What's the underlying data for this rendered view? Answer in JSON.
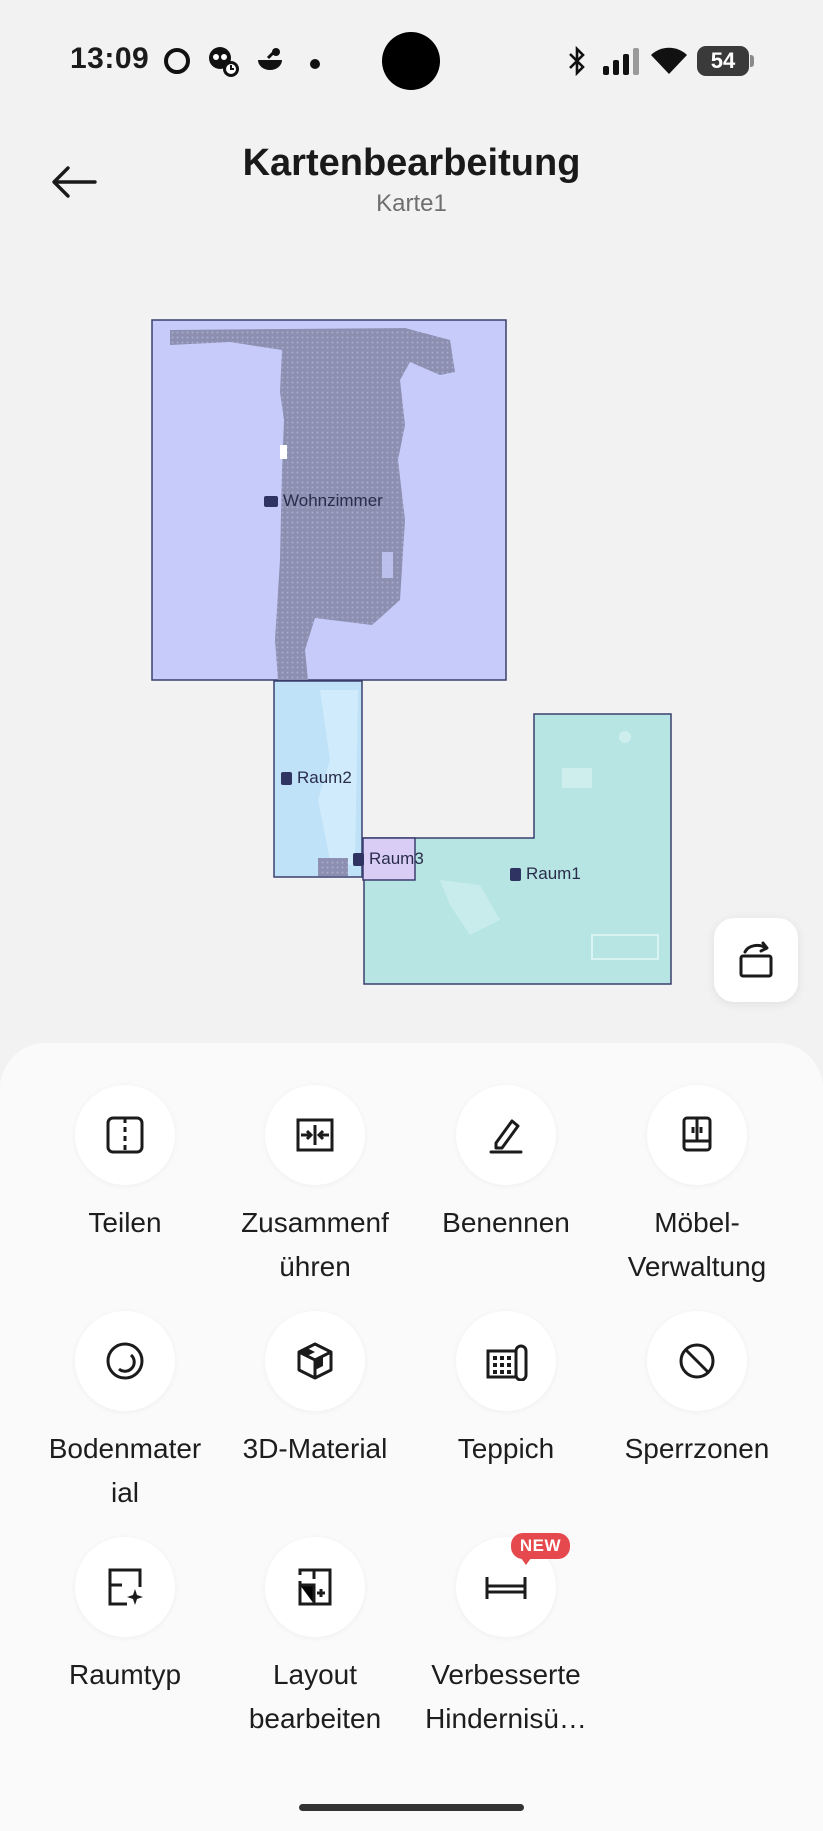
{
  "status_bar": {
    "time": "13:09",
    "battery": "54",
    "icons": [
      "circle-icon",
      "monkey-icon",
      "alarm-icon",
      "bluetooth-icon",
      "signal-icon",
      "wifi-icon",
      "battery-icon"
    ]
  },
  "header": {
    "title": "Kartenbearbeitung",
    "subtitle": "Karte1"
  },
  "map": {
    "rooms": [
      {
        "name": "Wohnzimmer",
        "color": "#c6cbfa"
      },
      {
        "name": "Raum2",
        "color": "#bfe2f8"
      },
      {
        "name": "Raum3",
        "color": "#d9cdf6"
      },
      {
        "name": "Raum1",
        "color": "#b6e5e4"
      }
    ]
  },
  "tools": [
    {
      "label": "Teilen",
      "icon": "split-icon"
    },
    {
      "label": "Zusammenf\nühren",
      "icon": "merge-icon"
    },
    {
      "label": "Benennen",
      "icon": "pencil-icon"
    },
    {
      "label": "Möbel-\nVerwaltung",
      "icon": "furniture-icon"
    },
    {
      "label": "Bodenmater\nial",
      "icon": "floor-material-icon"
    },
    {
      "label": "3D-Material",
      "icon": "cube-icon"
    },
    {
      "label": "Teppich",
      "icon": "carpet-icon"
    },
    {
      "label": "Sperrzonen",
      "icon": "no-go-icon"
    },
    {
      "label": "Raumtyp",
      "icon": "room-type-icon"
    },
    {
      "label": "Layout\nbearbeiten",
      "icon": "layout-icon"
    },
    {
      "label": "Verbesserte\nHindernisü…",
      "icon": "bed-icon",
      "badge": "NEW"
    }
  ]
}
